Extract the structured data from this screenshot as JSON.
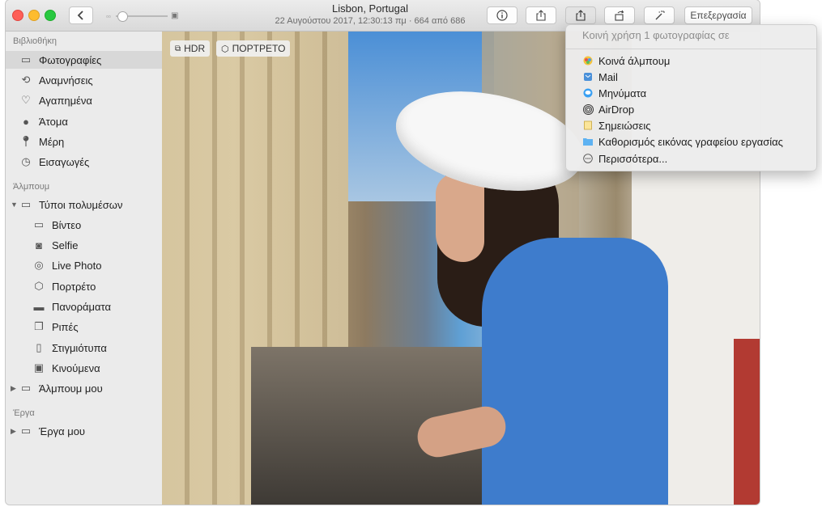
{
  "window": {
    "title": "Lisbon, Portugal",
    "subtitle": "22 Αυγούστου 2017, 12:30:13 πμ · 664 από 686"
  },
  "toolbar": {
    "edit_label": "Επεξεργασία"
  },
  "photo": {
    "badges": [
      {
        "label": "HDR",
        "icon": "hdr-icon"
      },
      {
        "label": "ΠΟΡΤΡΕΤΟ",
        "icon": "cube-icon"
      }
    ]
  },
  "sidebar": {
    "sections": {
      "library": "Βιβλιοθήκη",
      "albums": "Άλμπουμ",
      "projects": "Έργα"
    },
    "library_items": [
      {
        "label": "Φωτογραφίες",
        "icon": "photos-icon"
      },
      {
        "label": "Αναμνήσεις",
        "icon": "memories-icon"
      },
      {
        "label": "Αγαπημένα",
        "icon": "heart-icon"
      },
      {
        "label": "Άτομα",
        "icon": "person-icon"
      },
      {
        "label": "Μέρη",
        "icon": "pin-icon"
      },
      {
        "label": "Εισαγωγές",
        "icon": "clock-icon"
      }
    ],
    "media_types": {
      "label": "Τύποι πολυμέσων",
      "items": [
        {
          "label": "Βίντεο",
          "icon": "video-icon"
        },
        {
          "label": "Selfie",
          "icon": "camera-icon"
        },
        {
          "label": "Live Photo",
          "icon": "live-photo-icon"
        },
        {
          "label": "Πορτρέτο",
          "icon": "cube-icon"
        },
        {
          "label": "Πανοράματα",
          "icon": "panorama-icon"
        },
        {
          "label": "Ριπές",
          "icon": "burst-icon"
        },
        {
          "label": "Στιγμιότυπα",
          "icon": "phone-icon"
        },
        {
          "label": "Κινούμενα",
          "icon": "animated-icon"
        }
      ]
    },
    "my_albums": "Άλμπουμ μου",
    "my_projects": "Έργα μου"
  },
  "share_menu": {
    "header": "Κοινή χρήση 1 φωτογραφίας σε",
    "items": [
      {
        "label": "Κοινά άλμπουμ",
        "icon": "shared-albums-icon"
      },
      {
        "label": "Mail",
        "icon": "mail-icon"
      },
      {
        "label": "Μηνύματα",
        "icon": "messages-icon"
      },
      {
        "label": "AirDrop",
        "icon": "airdrop-icon"
      },
      {
        "label": "Σημειώσεις",
        "icon": "notes-icon"
      },
      {
        "label": "Καθορισμός εικόνας γραφείου εργασίας",
        "icon": "desktop-folder-icon"
      },
      {
        "label": "Περισσότερα...",
        "icon": "more-icon"
      }
    ]
  },
  "colors": {
    "accent": "#3478f6",
    "selection": "#d8d8d8"
  }
}
